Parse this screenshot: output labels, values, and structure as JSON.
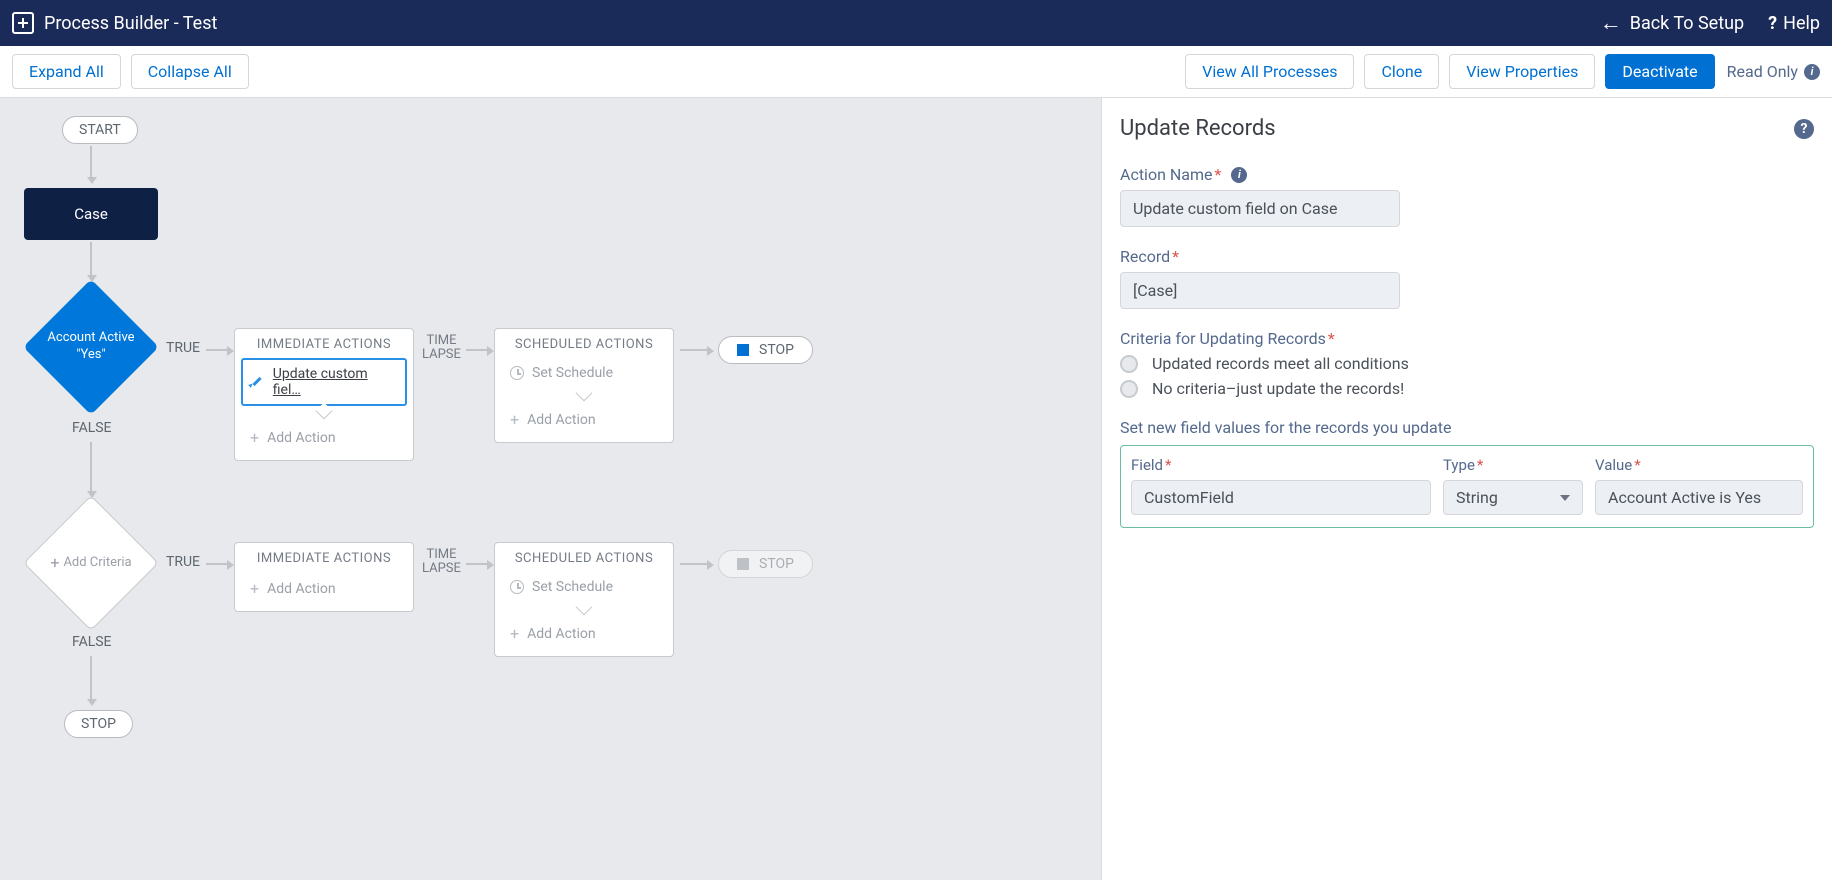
{
  "header": {
    "title": "Process Builder - Test",
    "back_label": "Back To Setup",
    "help_label": "Help"
  },
  "toolbar": {
    "expand_all": "Expand All",
    "collapse_all": "Collapse All",
    "view_all_processes": "View All Processes",
    "clone": "Clone",
    "view_properties": "View Properties",
    "deactivate": "Deactivate",
    "read_only": "Read Only"
  },
  "canvas": {
    "start": "START",
    "object": "Case",
    "criteria1_line1": "Account Active",
    "criteria1_line2": "\"Yes\"",
    "true_label": "TRUE",
    "false_label": "FALSE",
    "immediate_title": "IMMEDIATE ACTIONS",
    "scheduled_title": "SCHEDULED ACTIONS",
    "action_selected": "Update custom fiel…",
    "add_action": "Add Action",
    "set_schedule": "Set Schedule",
    "time_lapse": "TIME\nLAPSE",
    "stop": "STOP",
    "add_criteria": "Add Criteria"
  },
  "panel": {
    "title": "Update Records",
    "action_name_label": "Action Name",
    "action_name_value": "Update custom field on Case",
    "record_label": "Record",
    "record_value": "[Case]",
    "criteria_label": "Criteria for Updating Records",
    "radio1": "Updated records meet all conditions",
    "radio2": "No criteria–just update the records!",
    "set_values_label": "Set new field values for the records you update",
    "col_field": "Field",
    "col_type": "Type",
    "col_value": "Value",
    "row": {
      "field": "CustomField",
      "type": "String",
      "value": "Account Active is Yes"
    }
  }
}
